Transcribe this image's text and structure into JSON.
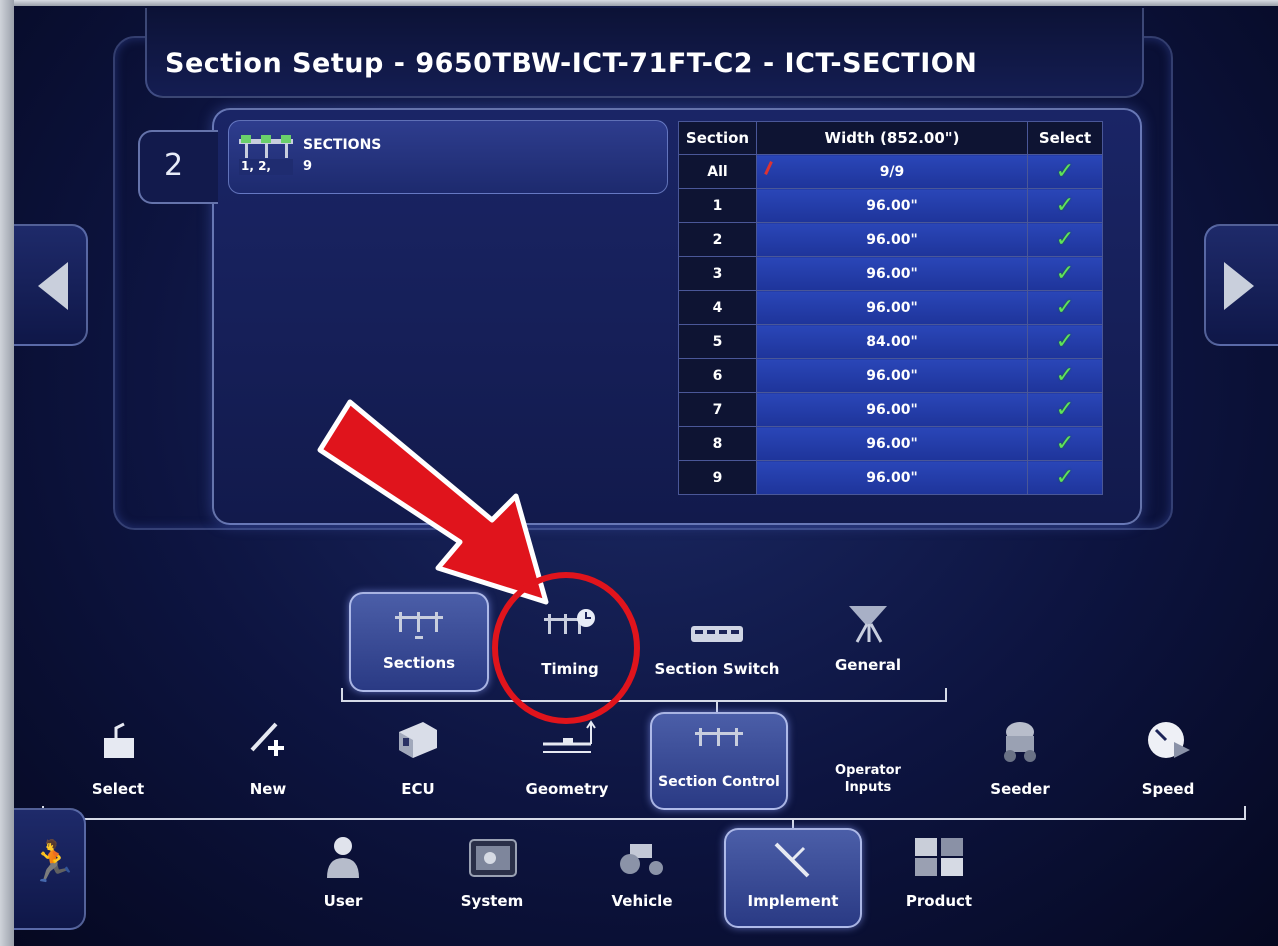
{
  "title": "Section Setup - 9650TBW-ICT-71FT-C2 - ICT-SECTION",
  "index_tab": "2",
  "sections_summary": {
    "label": "SECTIONS",
    "value": "9",
    "icon_numbers": "1, 2,"
  },
  "table": {
    "headers": [
      "Section",
      "Width (852.00\")",
      "Select"
    ],
    "rows": [
      {
        "section": "All",
        "width": "9/9",
        "selected": true
      },
      {
        "section": "1",
        "width": "96.00\"",
        "selected": true
      },
      {
        "section": "2",
        "width": "96.00\"",
        "selected": true
      },
      {
        "section": "3",
        "width": "96.00\"",
        "selected": true
      },
      {
        "section": "4",
        "width": "96.00\"",
        "selected": true
      },
      {
        "section": "5",
        "width": "84.00\"",
        "selected": true
      },
      {
        "section": "6",
        "width": "96.00\"",
        "selected": true
      },
      {
        "section": "7",
        "width": "96.00\"",
        "selected": true
      },
      {
        "section": "8",
        "width": "96.00\"",
        "selected": true
      },
      {
        "section": "9",
        "width": "96.00\"",
        "selected": true
      }
    ],
    "check_glyph": "✓"
  },
  "submenu": {
    "sections": "Sections",
    "timing": "Timing",
    "section_switch": "Section Switch",
    "general": "General"
  },
  "implement_menu": {
    "select": "Select",
    "new": "New",
    "ecu": "ECU",
    "geometry": "Geometry",
    "section_control": "Section Control",
    "operator_inputs_1": "Operator",
    "operator_inputs_2": "Inputs",
    "seeder": "Seeder",
    "speed": "Speed"
  },
  "main_menu": {
    "user": "User",
    "system": "System",
    "vehicle": "Vehicle",
    "implement": "Implement",
    "product": "Product"
  },
  "colors": {
    "accent": "#2a46b8",
    "check": "#5fe25a",
    "annotation": "#e0141c"
  }
}
